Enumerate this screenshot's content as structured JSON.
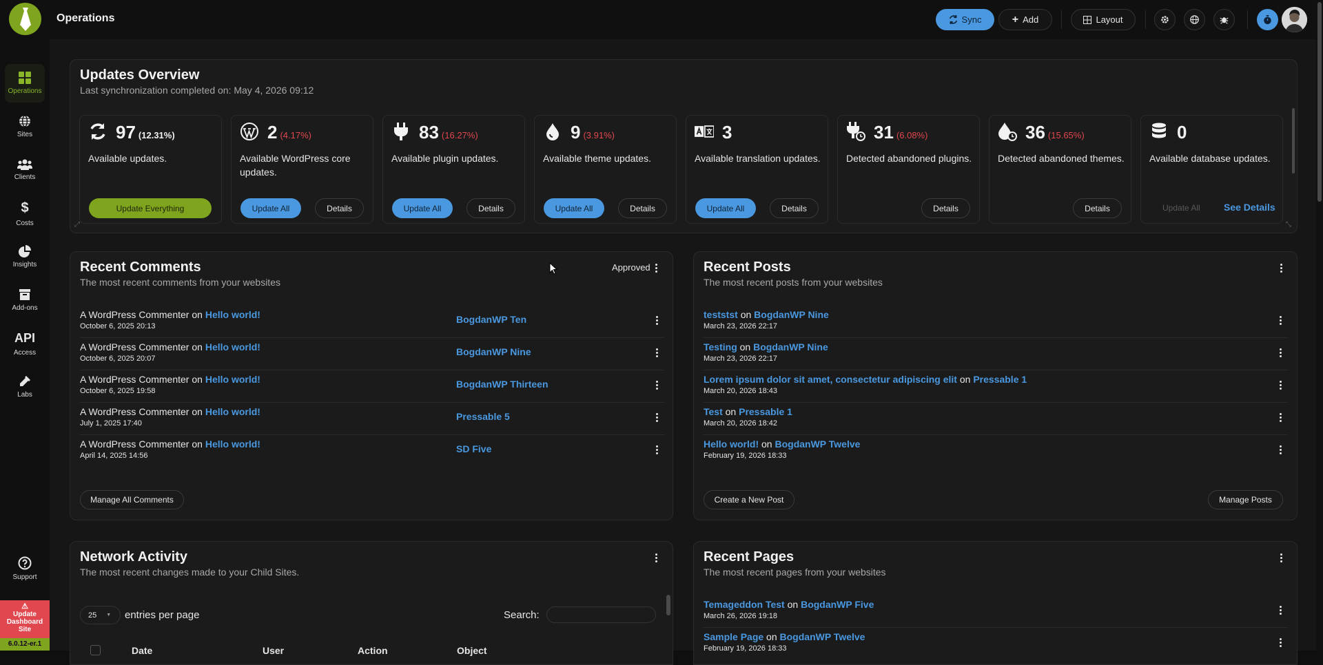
{
  "topbar": {
    "title": "Operations",
    "sync_label": "Sync",
    "add_label": "Add",
    "layout_label": "Layout"
  },
  "sidebar": {
    "items": [
      {
        "label": "Operations",
        "icon": "grid-icon"
      },
      {
        "label": "Sites",
        "icon": "globe-icon"
      },
      {
        "label": "Clients",
        "icon": "users-icon"
      },
      {
        "label": "Costs",
        "icon": "dollar-icon"
      },
      {
        "label": "Insights",
        "icon": "pie-chart-icon"
      },
      {
        "label": "Add-ons",
        "icon": "box-icon"
      },
      {
        "label": "Access",
        "icon": "api-icon",
        "badge": "API"
      },
      {
        "label": "Labs",
        "icon": "flask-icon"
      }
    ],
    "support_label": "Support",
    "update_dashboard_label": "Update Dashboard Site",
    "version": "6.0.12-er.1"
  },
  "updates": {
    "title": "Updates Overview",
    "subtitle": "Last synchronization completed on: May 4, 2026 09:12",
    "cards": [
      {
        "count": "97",
        "pct": "(12.31%)",
        "desc": "Available updates.",
        "primary": "Update Everything",
        "icon": "sync-icon"
      },
      {
        "count": "2",
        "pct": "(4.17%)",
        "desc": "Available WordPress core updates.",
        "primary": "Update All",
        "secondary": "Details",
        "icon": "wordpress-icon"
      },
      {
        "count": "83",
        "pct": "(16.27%)",
        "desc": "Available plugin updates.",
        "primary": "Update All",
        "secondary": "Details",
        "icon": "plug-icon"
      },
      {
        "count": "9",
        "pct": "(3.91%)",
        "desc": "Available theme updates.",
        "primary": "Update All",
        "secondary": "Details",
        "icon": "drop-icon"
      },
      {
        "count": "3",
        "pct": "",
        "desc": "Available translation updates.",
        "primary": "Update All",
        "secondary": "Details",
        "icon": "translate-icon"
      },
      {
        "count": "31",
        "pct": "(6.08%)",
        "desc": "Detected abandoned plugins.",
        "secondary": "Details",
        "icon": "plug-clock-icon"
      },
      {
        "count": "36",
        "pct": "(15.65%)",
        "desc": "Detected abandoned themes.",
        "secondary": "Details",
        "icon": "drop-clock-icon"
      },
      {
        "count": "0",
        "pct": "",
        "desc": "Available database updates.",
        "disabled": "Update All",
        "link": "See Details",
        "icon": "database-icon"
      }
    ]
  },
  "comments": {
    "title": "Recent Comments",
    "subtitle": "The most recent comments from your websites",
    "filter": "Approved",
    "on": "on",
    "rows": [
      {
        "author": "A WordPress Commenter",
        "post": "Hello world!",
        "date": "October 6, 2025 20:13",
        "site": "BogdanWP Ten"
      },
      {
        "author": "A WordPress Commenter",
        "post": "Hello world!",
        "date": "October 6, 2025 20:07",
        "site": "BogdanWP Nine"
      },
      {
        "author": "A WordPress Commenter",
        "post": "Hello world!",
        "date": "October 6, 2025 19:58",
        "site": "BogdanWP Thirteen"
      },
      {
        "author": "A WordPress Commenter",
        "post": "Hello world!",
        "date": "July 1, 2025 17:40",
        "site": "Pressable 5"
      },
      {
        "author": "A WordPress Commenter",
        "post": "Hello world!",
        "date": "April 14, 2025 14:56",
        "site": "SD Five"
      }
    ],
    "manage_label": "Manage All Comments"
  },
  "posts": {
    "title": "Recent Posts",
    "subtitle": "The most recent posts from your websites",
    "on": "on",
    "rows": [
      {
        "post": "teststst",
        "site": "BogdanWP Nine",
        "date": "March 23, 2026 22:17"
      },
      {
        "post": "Testing",
        "site": "BogdanWP Nine",
        "date": "March 23, 2026 22:17"
      },
      {
        "post": "Lorem ipsum dolor sit amet, consectetur adipiscing elit",
        "site": "Pressable 1",
        "date": "March 20, 2026 18:43"
      },
      {
        "post": "Test",
        "site": "Pressable 1",
        "date": "March 20, 2026 18:42"
      },
      {
        "post": "Hello world!",
        "site": "BogdanWP Twelve",
        "date": "February 19, 2026 18:33"
      }
    ],
    "create_label": "Create a New Post",
    "manage_label": "Manage Posts"
  },
  "network": {
    "title": "Network Activity",
    "subtitle": "The most recent changes made to your Child Sites.",
    "entries_value": "25",
    "entries_label": "entries per page",
    "search_label": "Search:",
    "columns": [
      "Date",
      "User",
      "Action",
      "Object"
    ]
  },
  "pages": {
    "title": "Recent Pages",
    "subtitle": "The most recent pages from your websites",
    "on": "on",
    "rows": [
      {
        "page": "Temageddon Test",
        "site": "BogdanWP Five",
        "date": "March 26, 2026 19:18"
      },
      {
        "page": "Sample Page",
        "site": "BogdanWP Twelve",
        "date": "February 19, 2026 18:33"
      }
    ]
  },
  "colors": {
    "accent_blue": "#4a98e0",
    "brand_green": "#7fa51e",
    "danger_red": "#e0474f"
  }
}
